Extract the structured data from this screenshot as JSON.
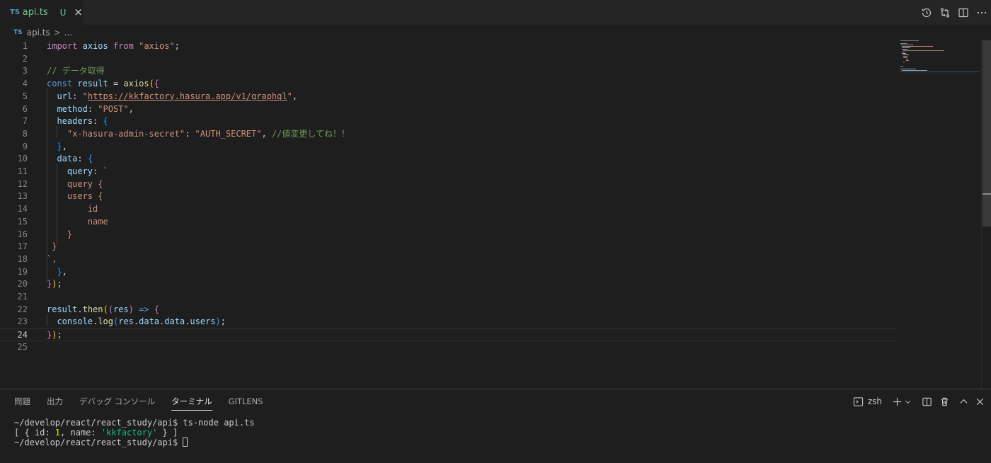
{
  "tab": {
    "badge": "TS",
    "filename": "api.ts",
    "status": "U",
    "close": "×"
  },
  "tab_actions": [
    "timeline-icon",
    "git-compare-icon",
    "split-editor-icon",
    "more-icon"
  ],
  "breadcrumb": {
    "badge": "TS",
    "file": "api.ts",
    "separator": ">",
    "more": "..."
  },
  "editor": {
    "current_line": 24,
    "line_numbers": [
      "1",
      "2",
      "3",
      "4",
      "5",
      "6",
      "7",
      "8",
      "9",
      "10",
      "11",
      "12",
      "13",
      "14",
      "15",
      "16",
      "17",
      "18",
      "19",
      "20",
      "21",
      "22",
      "23",
      "24",
      "25"
    ],
    "tokens": {
      "l1": [
        "import",
        "axios",
        "from",
        "\"axios\"",
        ";"
      ],
      "l3": "// データ取得",
      "l4": [
        "const",
        "result",
        "=",
        "axios",
        "(",
        "{"
      ],
      "l5": [
        "url",
        ":",
        "\"",
        "https://kkfactory.hasura.app/v1/graphql",
        "\"",
        ","
      ],
      "l6": [
        "method",
        ":",
        "\"POST\"",
        ","
      ],
      "l7": [
        "headers",
        ":",
        "{"
      ],
      "l8": [
        "\"x-hasura-admin-secret\"",
        ":",
        "\"AUTH_SECRET\"",
        ",",
        "//値変更してね！！"
      ],
      "l9": [
        "}",
        ","
      ],
      "l10": [
        "data",
        ":",
        "{"
      ],
      "l11": [
        "query",
        ":",
        "`"
      ],
      "l12": "query {",
      "l13": "users {",
      "l14": "id",
      "l15": "name",
      "l16": "}",
      "l17": "}",
      "l18": "`,",
      "l19": [
        "}",
        ","
      ],
      "l20": [
        "}",
        ")",
        ";"
      ],
      "l22": [
        "result",
        ".",
        "then",
        "(",
        "(",
        "res",
        ")",
        "=>",
        "{"
      ],
      "l23": [
        "console",
        ".",
        "log",
        "(",
        "res",
        ".",
        "data",
        ".",
        "data",
        ".",
        "users",
        ")",
        ";"
      ],
      "l24": [
        "}",
        ")",
        ";"
      ]
    }
  },
  "panel": {
    "tabs": [
      "問題",
      "出力",
      "デバッグ コンソール",
      "ターミナル",
      "GITLENS"
    ],
    "active_tab": "ターミナル",
    "shell": "zsh",
    "terminal": {
      "prompt1": "~/develop/react/react_study/api$ ts-node api.ts",
      "out_open": "[ { id: ",
      "out_id": "1",
      "out_mid": ", name: ",
      "out_name": "'kkfactory'",
      "out_close": " } ]",
      "prompt2": "~/develop/react/react_study/api$ "
    }
  }
}
